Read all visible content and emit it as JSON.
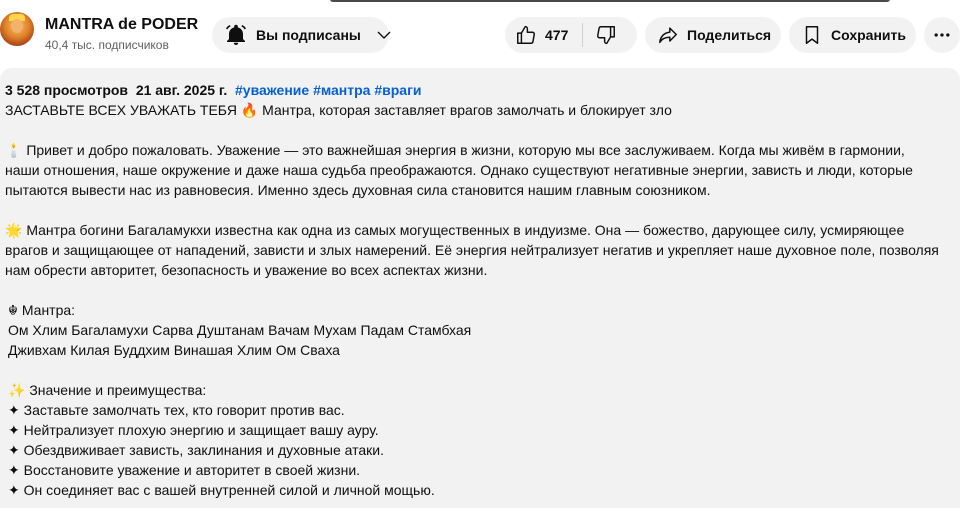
{
  "channel": {
    "name": "MANTRA de PODER",
    "subscribers": "40,4 тыс. подписчиков"
  },
  "actions": {
    "subscribed_label": "Вы подписаны",
    "like_count": "477",
    "share_label": "Поделиться",
    "save_label": "Сохранить"
  },
  "description": {
    "views": "3 528 просмотров",
    "date": "21 авг. 2025 г.",
    "hashtags": [
      "#уважение",
      "#мантра",
      "#враги"
    ],
    "title_line": "ЗАСТАВЬТЕ ВСЕХ УВАЖАТЬ ТЕБЯ 🔥 Мантра, которая заставляет врагов замолчать и блокирует зло",
    "intro_lines": [
      "🕯️ Привет и добро пожаловать. Уважение — это важнейшая энергия в жизни, которую мы все заслуживаем. Когда мы живём в гармонии,",
      "наши отношения, наше окружение и даже наша судьба преображаются. Однако существуют негативные энергии, зависть и люди, которые",
      "пытаются вывести нас из равновесия. Именно здесь духовная сила становится нашим главным союзником."
    ],
    "mantra_intro_lines": [
      "🌟 Мантра богини Багаламукхи известна как одна из самых могущественных в индуизме. Она — божество, дарующее силу, усмиряющее",
      "врагов и защищающее от нападений, зависти и злых намерений. Её энергия нейтрализует негатив и укрепляет наше духовное поле, позволяя",
      "нам обрести авторитет, безопасность и уважение во всех аспектах жизни."
    ],
    "mantra_heading": "☬ Мантра:",
    "mantra_lines": [
      "Ом Хлим Багаламухи Сарва Душтанам Вачам Мухам Падам Стамбхая",
      "Дживхам Килая Буддхим Винашая Хлим Ом Сваха"
    ],
    "benefits_heading": "✨ Значение и преимущества:",
    "benefits": [
      "✦ Заставьте замолчать тех, кто говорит против вас.",
      "✦ Нейтрализует плохую энергию и защищает вашу ауру.",
      "✦ Обездвиживает зависть, заклинания и духовные атаки.",
      "✦ Восстановите уважение и авторитет в своей жизни.",
      "✦ Он соединяет вас с вашей внутренней силой и личной мощью."
    ]
  },
  "icons": {
    "bell": "bell-filled-icon",
    "chevron": "chevron-down-icon",
    "like": "thumb-up-icon",
    "dislike": "thumb-down-icon",
    "share": "share-arrow-icon",
    "save": "bookmark-icon",
    "more": "more-horizontal-icon"
  },
  "colors": {
    "hashtag": "#065fd4",
    "pill_bg": "#f2f2f2",
    "text": "#0f0f0f",
    "secondary_text": "#606060"
  }
}
